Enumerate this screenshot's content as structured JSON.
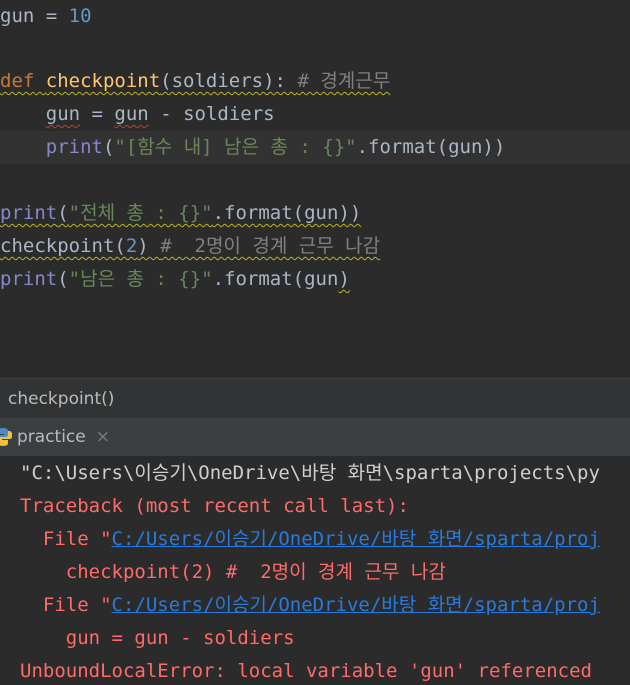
{
  "editor": {
    "l1": {
      "a": "gun",
      "b": " = ",
      "c": "10"
    },
    "l2": {
      "kw": "def",
      "sp": " ",
      "fn": "checkpoint",
      "p": "(soldiers): ",
      "cmt": "# 경계근무"
    },
    "l3": {
      "ind": "    ",
      "a": "gun",
      "b": " = ",
      "c": "gun",
      "d": " - soldiers"
    },
    "l4": {
      "ind": "    ",
      "fn": "print",
      "p1": "(",
      "s": "\"[함수 내] 남은 총 : {}\"",
      "p2": ".format(gun))"
    },
    "l5": {
      "fn": "print",
      "p1": "(",
      "s": "\"전체 총 : {}\"",
      "p2": ".format(gun))"
    },
    "l6": {
      "a": "checkpoint(",
      "n": "2",
      "b": ") ",
      "cmt": "#  2명이 경계 근무 나감"
    },
    "l7": {
      "fn": "print",
      "p1": "(",
      "s": "\"남은 총 : {}\"",
      "p2": ".format(gun",
      "p3": ")"
    }
  },
  "breadcrumb": {
    "text": "checkpoint()"
  },
  "run": {
    "tab_label": "practice",
    "close": "×"
  },
  "console": {
    "c1": "\"C:\\Users\\이승기\\OneDrive\\바탕 화면\\sparta\\projects\\py",
    "c2": "Traceback (most recent call last):",
    "c3": {
      "pre": "  File \"",
      "link": "C:/Users/이승기/OneDrive/바탕 화면/sparta/proj"
    },
    "c4": "    checkpoint(2) #  2명이 경계 근무 나감",
    "c5": {
      "pre": "  File \"",
      "link": "C:/Users/이승기/OneDrive/바탕 화면/sparta/proj"
    },
    "c6": "    gun = gun - soldiers",
    "c7": "UnboundLocalError: local variable 'gun' referenced"
  }
}
